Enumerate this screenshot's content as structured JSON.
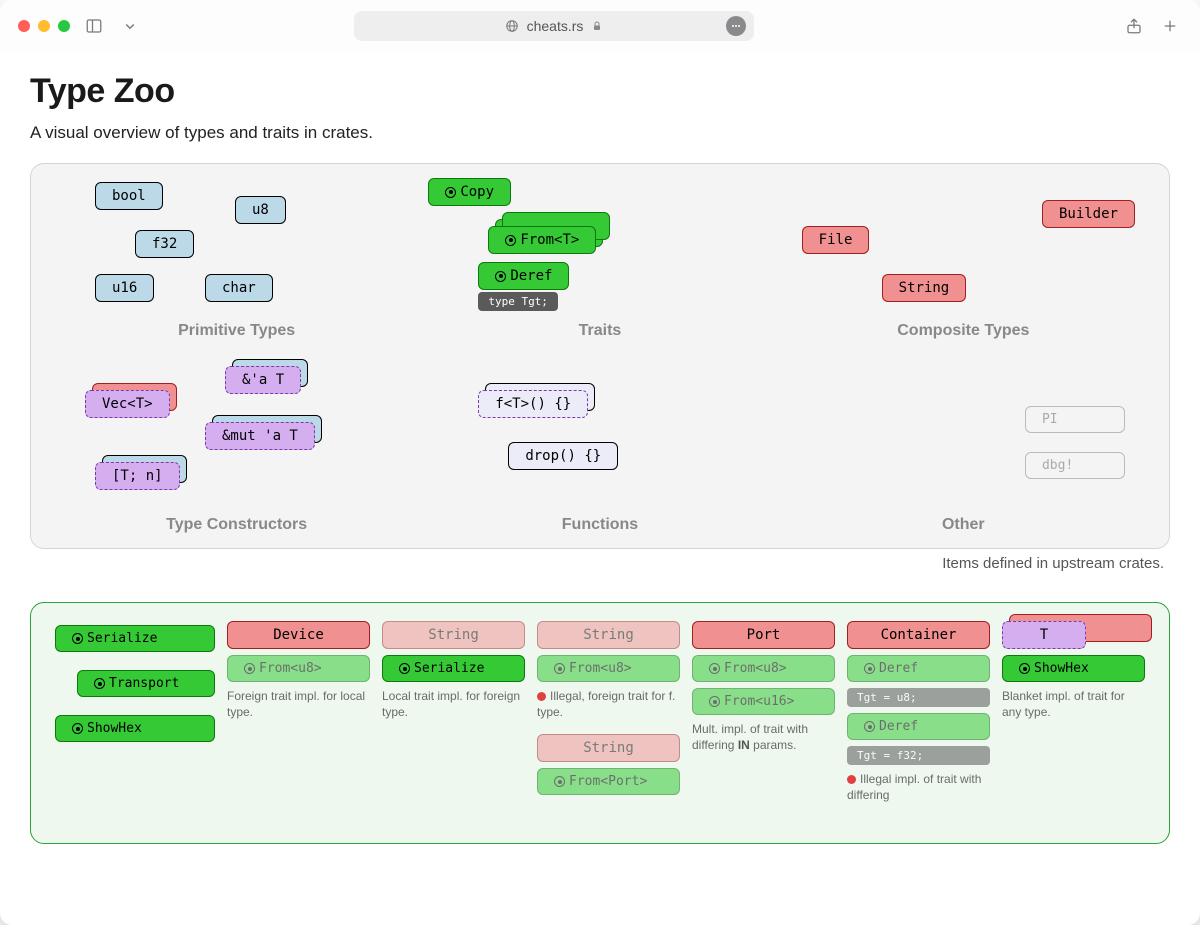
{
  "browser": {
    "url_host": "cheats.rs"
  },
  "page": {
    "title": "Type Zoo",
    "subtitle": "A visual overview of types and traits in crates."
  },
  "upstream": {
    "primitive_label": "Primitive Types",
    "traits_label": "Traits",
    "composite_label": "Composite Types",
    "constructors_label": "Type Constructors",
    "functions_label": "Functions",
    "other_label": "Other",
    "caption": "Items defined in upstream crates.",
    "primitives": {
      "bool": "bool",
      "u8": "u8",
      "f32": "f32",
      "u16": "u16",
      "char": "char"
    },
    "traits": {
      "copy": "Copy",
      "from_t": "From<T>",
      "deref": "Deref",
      "deref_assoc": "type Tgt;"
    },
    "composites": {
      "builder": "Builder",
      "file": "File",
      "string": "String"
    },
    "constructors": {
      "vec_t": "Vec<T>",
      "ref_t": "&'a T",
      "mut_ref_t": "&mut 'a T",
      "array": "[T; n]"
    },
    "functions": {
      "generic": "f<T>() {}",
      "drop": "drop() {}"
    },
    "other": {
      "pi": "PI",
      "dbg": "dbg!"
    }
  },
  "own": {
    "serialize": "Serialize",
    "transport": "Transport",
    "showhex": "ShowHex",
    "cols": {
      "device": {
        "head": "Device",
        "impl": "From<u8>",
        "desc": "Foreign trait impl. for local type."
      },
      "string1": {
        "head": "String",
        "impl": "Serialize",
        "desc": "Local trait impl. for foreign type."
      },
      "string2": {
        "head": "String",
        "impl": "From<u8>",
        "desc": "Illegal, foreign trait for f. type.",
        "head2": "String",
        "impl2": "From<Port>"
      },
      "port": {
        "head": "Port",
        "impl1": "From<u8>",
        "impl2": "From<u16>",
        "desc_a": "Mult. impl. of trait with differing ",
        "desc_b": "IN",
        "desc_c": " params."
      },
      "container": {
        "head": "Container",
        "impl1": "Deref",
        "tgt1": "Tgt = u8;",
        "impl2": "Deref",
        "tgt2": "Tgt = f32;",
        "desc": "Illegal impl. of trait with differing"
      },
      "t": {
        "head": "T",
        "impl": "ShowHex",
        "desc": "Blanket impl. of trait for any type."
      }
    }
  }
}
